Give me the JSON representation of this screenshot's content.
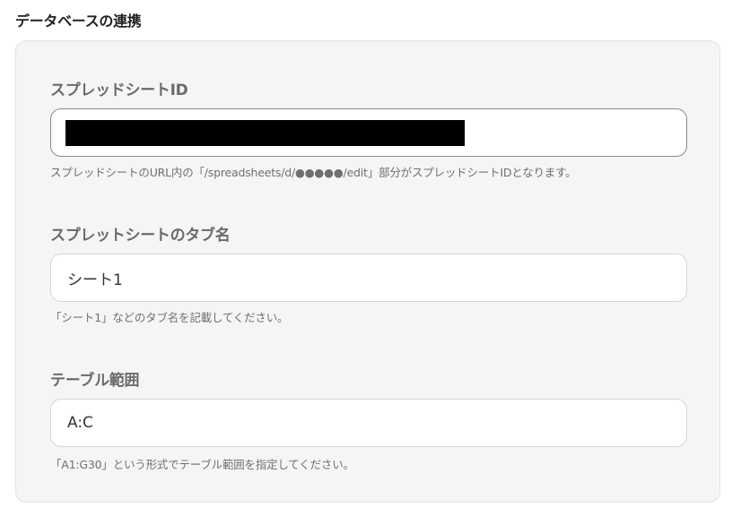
{
  "section": {
    "title": "データベースの連携"
  },
  "fields": {
    "spreadsheet_id": {
      "label": "スプレッドシートID",
      "value": "",
      "help": "スプレッドシートのURL内の「/spreadsheets/d/●●●●●/edit」部分がスプレッドシートIDとなります。"
    },
    "tab_name": {
      "label": "スプレットシートのタブ名",
      "value": "シート1",
      "help": "「シート1」などのタブ名を記載してください。"
    },
    "table_range": {
      "label": "テーブル範囲",
      "value": "A:C",
      "help": "「A1:G30」という形式でテーブル範囲を指定してください。"
    }
  },
  "colors": {
    "panel_background": "#f5f5f5",
    "label_text": "#6b6b6b",
    "help_text": "#6f6f6f",
    "redaction": "#000000"
  }
}
